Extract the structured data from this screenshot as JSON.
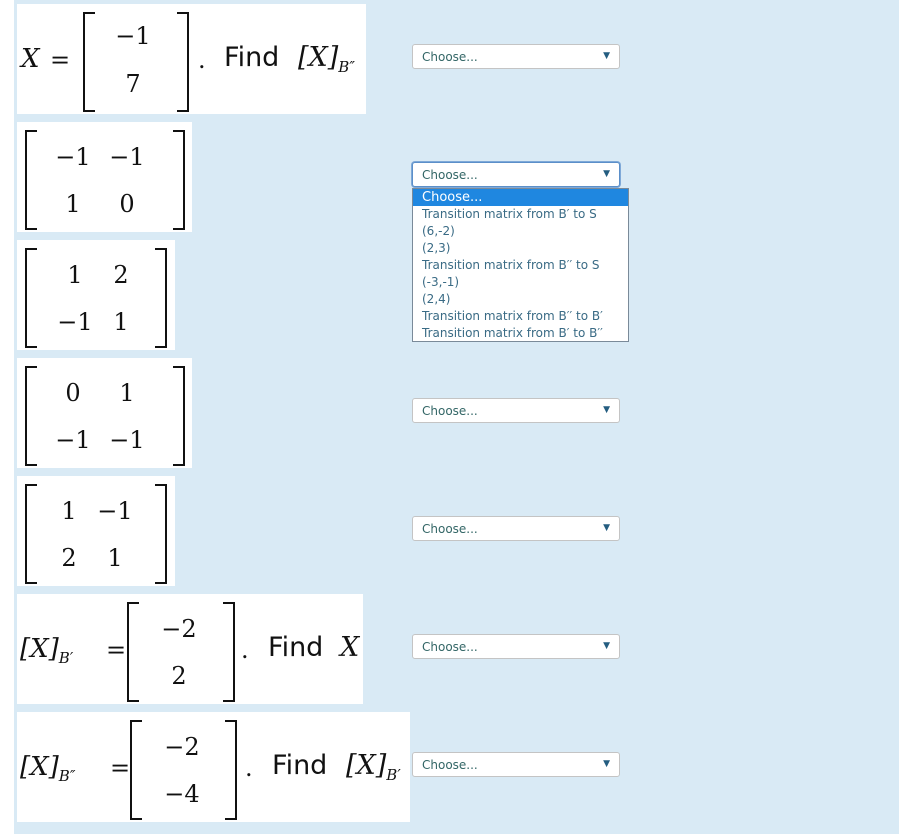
{
  "questions": [
    {
      "id": "q1",
      "lhs": "X",
      "equals": "=",
      "matrix": [
        "−1",
        "7"
      ],
      "find_label": "Find",
      "find_target": "[X]",
      "find_sub": "B″",
      "select": "Choose..."
    },
    {
      "id": "q2",
      "matrix": [
        "−1",
        "−1",
        "1",
        "0"
      ],
      "select": "Choose..."
    },
    {
      "id": "q3",
      "matrix": [
        "1",
        "2",
        "−1",
        "1"
      ],
      "select": "Choose..."
    },
    {
      "id": "q4",
      "matrix": [
        "0",
        "1",
        "−1",
        "−1"
      ],
      "select": "Choose..."
    },
    {
      "id": "q5",
      "matrix": [
        "1",
        "−1",
        "2",
        "1"
      ],
      "select": "Choose..."
    },
    {
      "id": "q6",
      "lhs": "[X]",
      "lhs_sub": "B′",
      "equals": "=",
      "matrix": [
        "−2",
        "2"
      ],
      "find_label": "Find",
      "find_target": "X",
      "select": "Choose..."
    },
    {
      "id": "q7",
      "lhs": "[X]",
      "lhs_sub": "B″",
      "equals": "=",
      "matrix": [
        "−2",
        "−4"
      ],
      "find_label": "Find",
      "find_target": "[X]",
      "find_sub": "B′",
      "select": "Choose..."
    }
  ],
  "dropdown_options": [
    "Choose...",
    "Transition matrix from B′ to S",
    "(6,-2)",
    "(2,3)",
    "Transition matrix from B′′ to S",
    "(-3,-1)",
    "(2,4)",
    "Transition matrix from B′′ to B′",
    "Transition matrix from B′ to B′′"
  ],
  "dropdown_selected_index": 0,
  "icons": {
    "caret": "caret-down-icon"
  },
  "colors": {
    "panel": "#d9eaf5",
    "highlight": "#1f87e0"
  }
}
